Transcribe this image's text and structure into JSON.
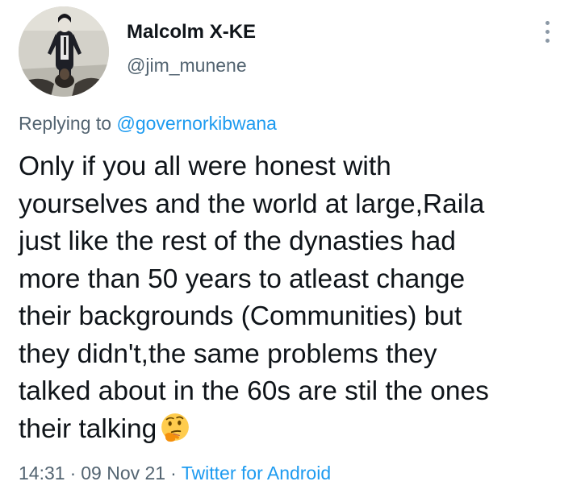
{
  "author": {
    "display_name": "Malcolm X-KE",
    "handle": "@jim_munene"
  },
  "icons": {
    "more": "more-vertical-icon",
    "emoji": "thinking-face-emoji"
  },
  "reply": {
    "prefix": "Replying to",
    "mention": "@governorkibwana"
  },
  "tweet": {
    "lines": [
      "Only if you all were honest with",
      "yourselves and the world at large,Raila",
      "just like the rest of the dynasties had",
      "more than 50 years to atleast change",
      "their backgrounds (Communities) but",
      "they didn't,the same problems they",
      "talked about in the 60s are stil the ones",
      "their talking"
    ]
  },
  "meta": {
    "time": "14:31",
    "separator": "·",
    "date": "09 Nov 21",
    "source": "Twitter for Android"
  },
  "colors": {
    "text": "#0f1419",
    "secondary": "#536471",
    "link": "#1d9bf0"
  }
}
